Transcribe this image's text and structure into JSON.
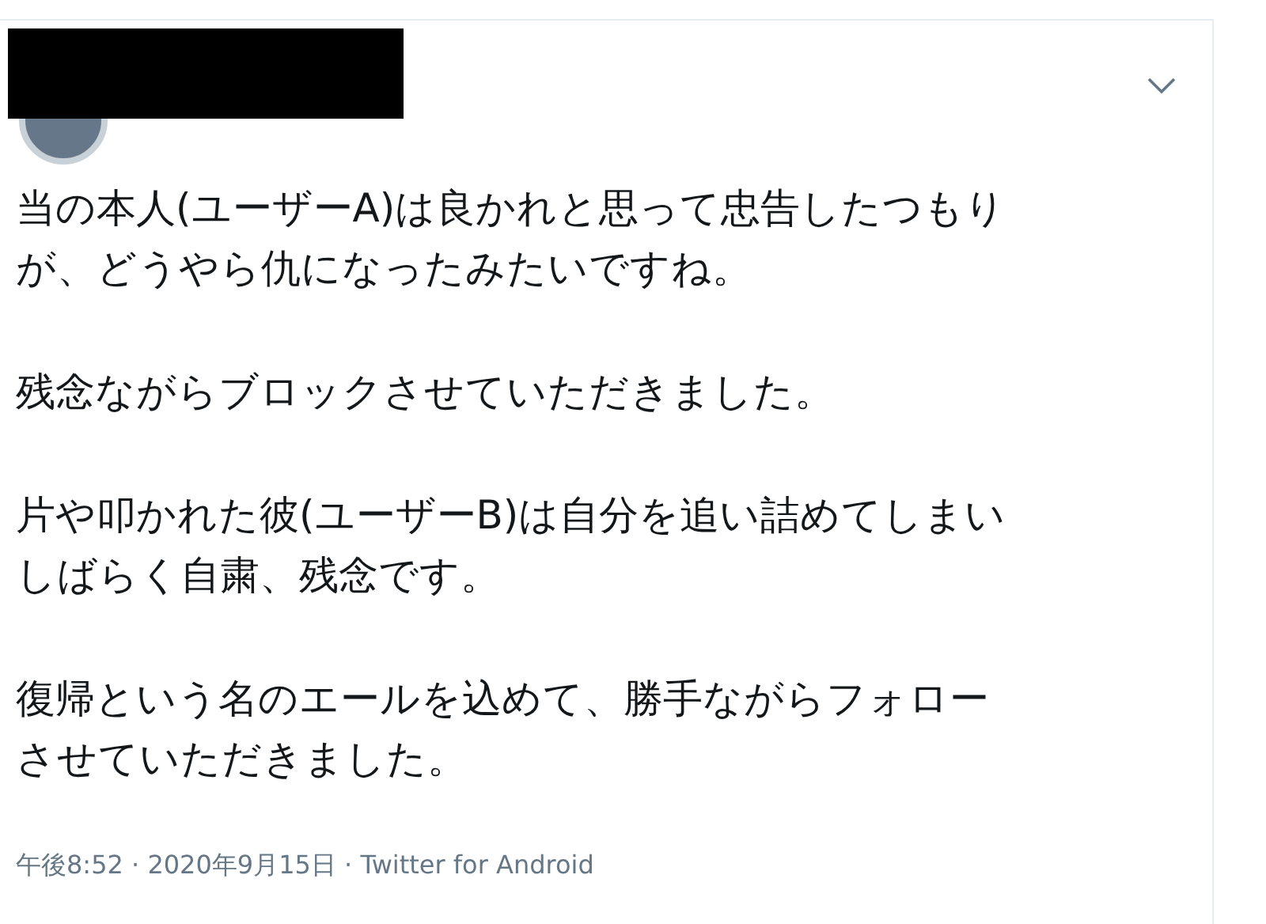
{
  "tweet": {
    "paragraphs": [
      {
        "lines": [
          "当の本人(ユーザーA)は良かれと思って忠告したつもり",
          "が、どうやら仇になったみたいですね。"
        ]
      },
      {
        "lines": [
          "残念ながらブロックさせていただきました。"
        ]
      },
      {
        "lines": [
          "片や叩かれた彼(ユーザーB)は自分を追い詰めてしまい",
          "しばらく自粛、残念です。"
        ]
      },
      {
        "lines": [
          "復帰という名のエールを込めて、勝手ながらフォロー",
          "させていただきました。"
        ]
      }
    ],
    "meta": "午後8:52 · 2020年9月15日 · Twitter for Android"
  }
}
